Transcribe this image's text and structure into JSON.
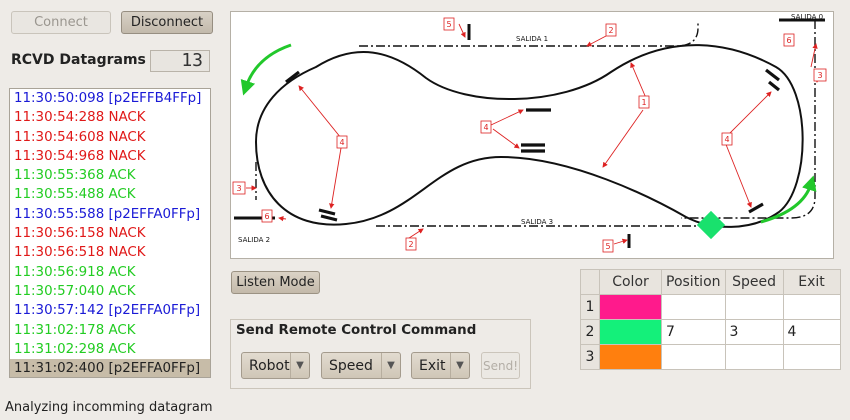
{
  "buttons": {
    "connect": "Connect",
    "disconnect": "Disconnect",
    "listen": "Listen Mode",
    "send": "Send!"
  },
  "rcvd": {
    "label": "RCVD Datagrams",
    "count": "13"
  },
  "log": [
    {
      "text": "11:30:50:098 [p2EFFB4FFp]",
      "color": "#1a1ad6"
    },
    {
      "text": "11:30:54:288 NACK",
      "color": "#e01818"
    },
    {
      "text": "11:30:54:608 NACK",
      "color": "#e01818"
    },
    {
      "text": "11:30:54:968 NACK",
      "color": "#e01818"
    },
    {
      "text": "11:30:55:368 ACK",
      "color": "#22cc22"
    },
    {
      "text": "11:30:55:488 ACK",
      "color": "#22cc22"
    },
    {
      "text": "11:30:55:588 [p2EFFA0FFp]",
      "color": "#1a1ad6"
    },
    {
      "text": "11:30:56:158 NACK",
      "color": "#e01818"
    },
    {
      "text": "11:30:56:518 NACK",
      "color": "#e01818"
    },
    {
      "text": "11:30:56:918 ACK",
      "color": "#22cc22"
    },
    {
      "text": "11:30:57:040 ACK",
      "color": "#22cc22"
    },
    {
      "text": "11:30:57:142 [p2EFFA0FFp]",
      "color": "#1a1ad6"
    },
    {
      "text": "11:31:02:178 ACK",
      "color": "#22cc22"
    },
    {
      "text": "11:31:02:298 ACK",
      "color": "#22cc22"
    },
    {
      "text": "11:31:02:400 [p2EFFA0FFp]",
      "color": "#222222",
      "selected": true
    }
  ],
  "track": {
    "salida_0": "SALIDA 0",
    "salida_1": "SALIDA 1",
    "salida_2": "SALIDA 2",
    "salida_3": "SALIDA 3",
    "callouts": {
      "c1": "1",
      "c2": "2",
      "c3": "3",
      "c4": "4",
      "c5": "5",
      "c6": "6"
    },
    "train_color": "#19e16d"
  },
  "command": {
    "title": "Send Remote Control Command",
    "robot": "Robot",
    "speed": "Speed",
    "exit": "Exit"
  },
  "grid": {
    "headers": [
      "Color",
      "Position",
      "Speed",
      "Exit"
    ],
    "rows": [
      {
        "id": "1",
        "color": "#ff1a8c",
        "position": "",
        "speed": "",
        "exit": ""
      },
      {
        "id": "2",
        "color": "#14f07a",
        "position": "7",
        "speed": "3",
        "exit": "4"
      },
      {
        "id": "3",
        "color": "#ff7f0e",
        "position": "",
        "speed": "",
        "exit": ""
      }
    ]
  },
  "status": "Analyzing incomming datagram"
}
